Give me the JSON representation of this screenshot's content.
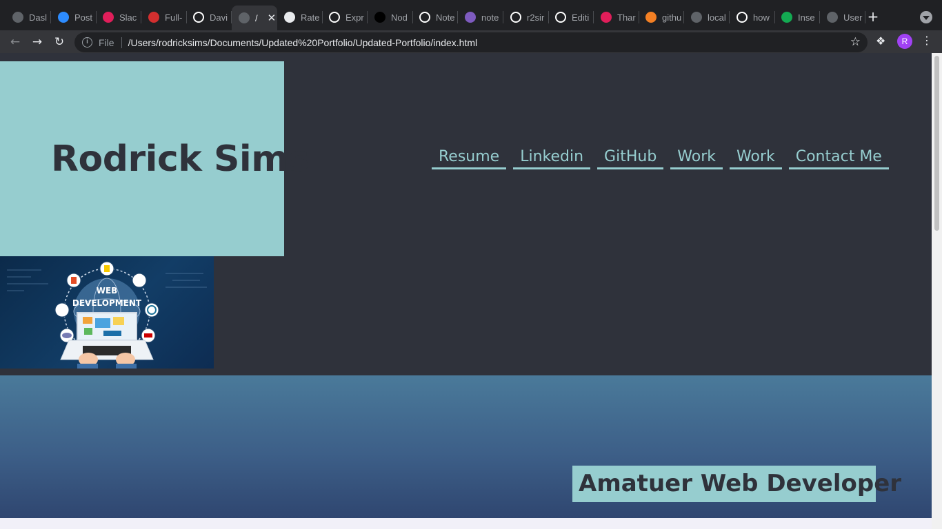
{
  "browser": {
    "tabs": [
      {
        "title": "Dasl",
        "icon": "globe-icon",
        "color": "#5f6368"
      },
      {
        "title": "Post",
        "icon": "zoom-icon",
        "color": "#2d8cff"
      },
      {
        "title": "Slac",
        "icon": "slack-icon",
        "color": "#e01e5a"
      },
      {
        "title": "Full-",
        "icon": "d-brand-icon",
        "color": "#d32f2f"
      },
      {
        "title": "Davi",
        "icon": "github-icon",
        "color": "#ffffff"
      },
      {
        "title": "/",
        "icon": "globe-icon",
        "color": "#5f6368",
        "active": true
      },
      {
        "title": "Rate",
        "icon": "rating-icon",
        "color": "#e8eaed"
      },
      {
        "title": "Expr",
        "icon": "express-icon",
        "color": "#ffffff"
      },
      {
        "title": "Nod",
        "icon": "dev-icon",
        "color": "#000000"
      },
      {
        "title": "Note",
        "icon": "github-icon",
        "color": "#ffffff"
      },
      {
        "title": "note",
        "icon": "heroku-icon",
        "color": "#7e5bbf"
      },
      {
        "title": "r2sir",
        "icon": "github-icon",
        "color": "#ffffff"
      },
      {
        "title": "Editi",
        "icon": "github-icon",
        "color": "#ffffff"
      },
      {
        "title": "Thar",
        "icon": "slack-icon",
        "color": "#e01e5a"
      },
      {
        "title": "githu",
        "icon": "stackoverflow-icon",
        "color": "#f48024"
      },
      {
        "title": "local",
        "icon": "globe-icon",
        "color": "#5f6368"
      },
      {
        "title": "how",
        "icon": "google-icon",
        "color": "#ffffff"
      },
      {
        "title": "Inse",
        "icon": "mongodb-icon",
        "color": "#13aa52"
      },
      {
        "title": "User",
        "icon": "globe-icon",
        "color": "#5f6368"
      }
    ],
    "close_symbol": "✕",
    "new_tab_symbol": "+",
    "address": {
      "scheme_label": "File",
      "url": "/Users/rodricksims/Documents/Updated%20Portfolio/Updated-Portfolio/index.html"
    },
    "profile_initial": "R"
  },
  "page": {
    "title": "Rodrick Sims",
    "nav": [
      {
        "label": "Resume"
      },
      {
        "label": "Linkedin"
      },
      {
        "label": "GitHub"
      },
      {
        "label": "Work"
      },
      {
        "label": "Work"
      },
      {
        "label": "Contact Me"
      }
    ],
    "hero_image_text": [
      "WEB",
      "DEVELOPMENT"
    ],
    "tagline": "Amatuer Web Developer",
    "colors": {
      "accent": "#96cdcf",
      "background": "#2f323b",
      "band_top": "#4a7a9a",
      "band_bottom": "#2f4670"
    }
  }
}
